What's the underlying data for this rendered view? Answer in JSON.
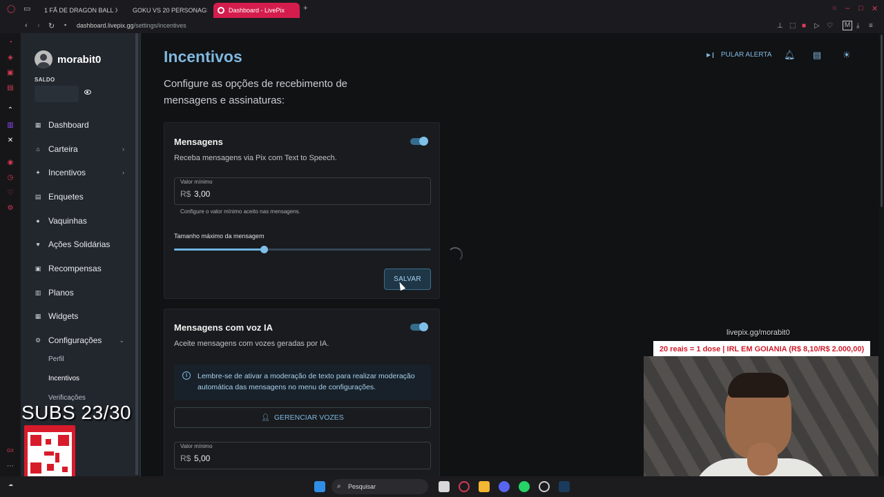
{
  "browser": {
    "tabs": [
      {
        "label": "1 FÃ DE DRAGON BALL X"
      },
      {
        "label": "GOKU VS 20 PERSONAGI"
      },
      {
        "label": "Dashboard - LivePix"
      }
    ],
    "url_host": "dashboard.livepix.gg",
    "url_path": "/settings/incentives"
  },
  "sidebar": {
    "username": "morabit0",
    "saldo_label": "SALDO",
    "items": [
      {
        "label": "Dashboard",
        "icon": "dashboard-icon"
      },
      {
        "label": "Carteira",
        "icon": "bank-icon",
        "expandable": true
      },
      {
        "label": "Incentivos",
        "icon": "sparkle-icon",
        "expandable": true
      },
      {
        "label": "Enquetes",
        "icon": "poll-icon"
      },
      {
        "label": "Vaquinhas",
        "icon": "piggy-bank-icon"
      },
      {
        "label": "Ações Solidárias",
        "icon": "heart-hand-icon"
      },
      {
        "label": "Recompensas",
        "icon": "gift-icon"
      },
      {
        "label": "Planos",
        "icon": "plans-icon"
      },
      {
        "label": "Widgets",
        "icon": "widgets-icon"
      },
      {
        "label": "Configurações",
        "icon": "gear-icon",
        "expanded": true
      }
    ],
    "subitems": [
      {
        "label": "Perfil"
      },
      {
        "label": "Incentivos",
        "active": true
      },
      {
        "label": "Verificações"
      }
    ]
  },
  "header": {
    "title": "Incentivos",
    "subtitle": "Configure as opções de recebimento de mensagens e assinaturas:",
    "skip_alert_label": "PULAR ALERTA"
  },
  "messages_card": {
    "title": "Mensagens",
    "description": "Receba mensagens via Pix com Text to Speech.",
    "enabled": true,
    "min_value_label": "Valor mínimo",
    "currency": "R$",
    "min_value": "3,00",
    "min_value_hint": "Configure o valor mínimo aceito nas mensagens.",
    "max_length_label": "Tamanho máximo da mensagem",
    "max_length_fraction": 0.35,
    "save_label": "SALVAR"
  },
  "ai_voice_card": {
    "title": "Mensagens com voz IA",
    "description": "Aceite mensagens com vozes geradas por IA.",
    "enabled": true,
    "info": "Lembre-se de ativar a moderação de texto para realizar moderação automática das mensagens no menu de configurações.",
    "manage_voices_label": "GERENCIAR VOZES",
    "min_value_label": "Valor mínimo",
    "currency": "R$",
    "min_value": "5,00"
  },
  "overlay": {
    "subs_counter": "SUBS 23/30",
    "donation_link": "livepix.gg/morabit0",
    "goal_text": "20 reais = 1 dose | IRL EM GOIANIA (R$ 8,10/R$ 2.000,00)"
  },
  "taskbar": {
    "search_placeholder": "Pesquisar"
  },
  "colors": {
    "accent": "#7fb8df",
    "tab_active": "#d41d4d",
    "goal_text": "#d11a2a"
  }
}
